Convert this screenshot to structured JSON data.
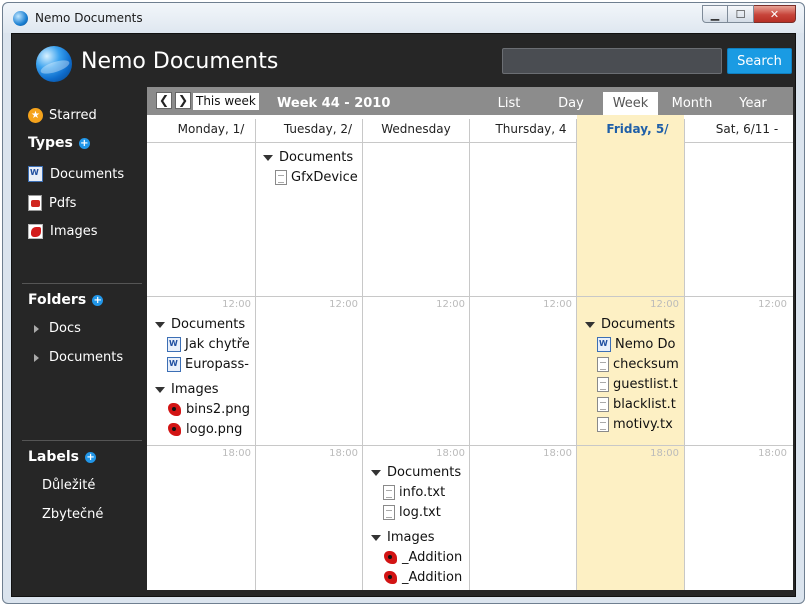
{
  "window": {
    "title": "Nemo Documents",
    "minimize": "▁",
    "maximize": "☐",
    "close": "✕"
  },
  "header": {
    "app_title": "Nemo Documents",
    "search_placeholder": "",
    "search_label": "Search"
  },
  "sidebar": {
    "starred": "Starred",
    "types_heading": "Types",
    "types": [
      "Documents",
      "Pdfs",
      "Images"
    ],
    "folders_heading": "Folders",
    "folders": [
      "Docs",
      "Documents"
    ],
    "labels_heading": "Labels",
    "labels": [
      "Důležité",
      "Zbytečné"
    ],
    "plus": "+",
    "star": "★"
  },
  "calendar": {
    "prev": "❮",
    "next": "❯",
    "this_week": "This week",
    "week_label": "Week 44 - 2010",
    "views": [
      "List",
      "Day",
      "Week",
      "Month",
      "Year"
    ],
    "active_view": "Week",
    "days": [
      "Monday, 1/",
      "Tuesday, 2/",
      "Wednesday",
      "Thursday, 4",
      "Friday, 5/",
      "Sat, 6/11 -"
    ],
    "today_index": 4,
    "time_labels": [
      "12:00",
      "18:00"
    ],
    "cells": {
      "tue_morning": {
        "group": "Documents",
        "files": [
          "GfxDevice"
        ]
      },
      "mon_noon": {
        "groups": [
          {
            "name": "Documents",
            "files": [
              "Jak chytře",
              "Europass-"
            ]
          },
          {
            "name": "Images",
            "files": [
              "bins2.png",
              "logo.png"
            ]
          }
        ]
      },
      "fri_noon": {
        "group": "Documents",
        "files": [
          "Nemo Do",
          "checksum",
          "guestlist.t",
          "blacklist.t",
          "motivy.tx"
        ]
      },
      "wed_evening": {
        "groups": [
          {
            "name": "Documents",
            "files": [
              "info.txt",
              "log.txt"
            ]
          },
          {
            "name": "Images",
            "files": [
              "_Addition",
              "_Addition"
            ]
          }
        ]
      }
    }
  }
}
